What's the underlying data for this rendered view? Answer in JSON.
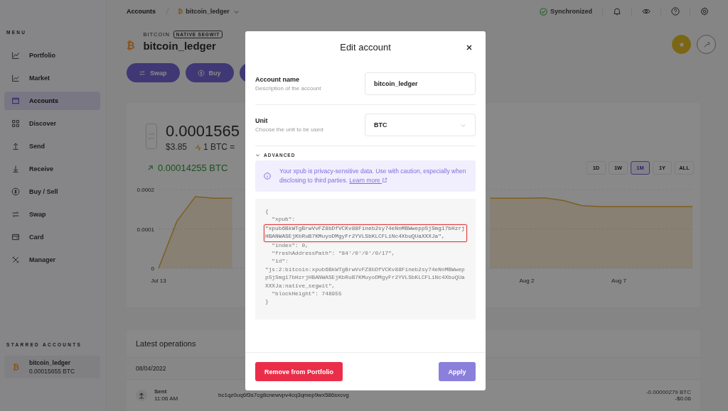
{
  "topbar": {
    "breadcrumb": [
      "Accounts",
      "bitcoin_ledger"
    ],
    "account_icon": "₿",
    "sync_status": "Synchronized"
  },
  "sidebar": {
    "menu_title": "MENU",
    "items": [
      {
        "label": "Portfolio",
        "selected": false
      },
      {
        "label": "Market",
        "selected": false
      },
      {
        "label": "Accounts",
        "selected": true
      },
      {
        "label": "Discover",
        "selected": false
      },
      {
        "label": "Send",
        "selected": false
      },
      {
        "label": "Receive",
        "selected": false
      },
      {
        "label": "Buy / Sell",
        "selected": false
      },
      {
        "label": "Swap",
        "selected": false
      },
      {
        "label": "Card",
        "selected": false
      },
      {
        "label": "Manager",
        "selected": false
      }
    ],
    "starred_title": "STARRED ACCOUNTS",
    "starred": [
      {
        "icon": "₿",
        "name": "bitcoin_ledger",
        "balance": "0.00015655 BTC"
      }
    ]
  },
  "account": {
    "icon": "₿",
    "currency": "BITCOIN",
    "badge": "NATIVE SEGWIT",
    "name": "bitcoin_ledger",
    "starred": true,
    "actions": [
      {
        "kind": "swap",
        "label": "Swap"
      },
      {
        "kind": "buy",
        "label": "Buy"
      },
      {
        "kind": "send"
      }
    ]
  },
  "balance": {
    "amount": "0.0001565",
    "fiat": "$3.85",
    "rate": "1 BTC =",
    "change": "0.00014255 BTC",
    "ranges": [
      {
        "label": "1D",
        "selected": false
      },
      {
        "label": "1W",
        "selected": false
      },
      {
        "label": "1M",
        "selected": true
      },
      {
        "label": "1Y",
        "selected": false
      },
      {
        "label": "ALL",
        "selected": false
      }
    ],
    "chart_data": {
      "type": "area",
      "categories": [
        "Jul 13",
        null,
        null,
        null,
        null,
        null,
        null,
        null,
        null,
        null,
        null,
        null,
        null,
        null,
        null,
        null,
        null,
        null,
        null,
        null,
        "Aug 2",
        null,
        null,
        null,
        null,
        "Aug 7",
        null,
        null,
        null,
        null
      ],
      "series": [
        {
          "color": "#e6a92a",
          "values": [
            0,
            0.00012,
            0.000182,
            0.000178,
            0.000178,
            null,
            null,
            null,
            null,
            null,
            null,
            null,
            null,
            null,
            null,
            null,
            null,
            null,
            0.000178,
            0.000178,
            0.000178,
            0.000179,
            0.000172,
            0.000159,
            0.000157,
            0.000157,
            0.000157,
            0.000157,
            0.000157,
            0.000157
          ]
        }
      ],
      "ylim": [
        0,
        0.0002
      ],
      "yticks": [
        0,
        0.0001,
        0.0002
      ]
    }
  },
  "operations": {
    "title": "Latest operations",
    "date": "08/04/2022",
    "rows": [
      {
        "type": "Sent",
        "time": "11:06 AM",
        "address": "bc1qz0uq6f3s7cg8cnewvpv4cq3qmep9wx586sxcvg",
        "amount": "-0.00000279 BTC",
        "fiat": "-$0.06"
      }
    ]
  },
  "modal": {
    "title": "Edit account",
    "fields": [
      {
        "kind": "text",
        "label": "Account name",
        "hint": "Description of the account",
        "value": "bitcoin_ledger"
      },
      {
        "kind": "select",
        "label": "Unit",
        "hint": "Choose the unit to be used",
        "value": "BTC"
      }
    ],
    "advanced": {
      "label": "ADVANCED",
      "expanded": true,
      "notice": "Your xpub is privacy-sensitive data. Use with caution, especially when disclosing to third parties.",
      "link": "Learn more",
      "code": [
        {
          "text": "{",
          "highlighted": false
        },
        {
          "text": "  \"xpub\":",
          "highlighted": false
        },
        {
          "text": "\"xpub6BkWTgBrwVvFZ8bDfVCKv88Fineb2sy74eNnMBWweppSjSmg17bHzrjHBANWASEjKbRuB7KMuyoDMgyFr2YVLSbKLCFLiNc4XbuQUaXXXJa\",",
          "highlighted": true
        },
        {
          "text": "  \"index\": 0,",
          "highlighted": false
        },
        {
          "text": "  \"freshAddressPath\": \"84'/0'/0'/0/17\",",
          "highlighted": false
        },
        {
          "text": "  \"id\":",
          "highlighted": false
        },
        {
          "text": "\"js:2:bitcoin:xpub6BkWTgBrwVvFZ8bDfVCKv88Fineb2sy74eNnMBWweppSjSmg17bHzrjHBANWASEjKbRuB7KMuyoDMgyFr2YVLSbKLCFLiNc4XbuQUaXXXJa:native_segwit\",",
          "highlighted": false
        },
        {
          "text": "  \"blockHeight\": 748955",
          "highlighted": false
        },
        {
          "text": "}",
          "highlighted": false
        }
      ]
    },
    "buttons": [
      {
        "kind": "danger",
        "label": "Remove from Portfolio"
      },
      {
        "kind": "primary",
        "label": "Apply"
      }
    ]
  }
}
